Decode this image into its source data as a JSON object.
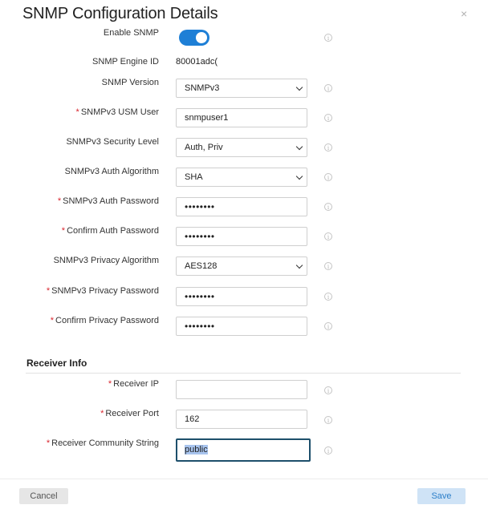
{
  "dialog": {
    "title": "SNMP Configuration Details"
  },
  "rows": [
    {
      "label": "Enable SNMP",
      "type": "toggle",
      "on": true
    },
    {
      "label": "SNMP Engine ID",
      "type": "text",
      "value": "80001adc("
    },
    {
      "label": "SNMP Version",
      "type": "select",
      "value": "SNMPv3"
    },
    {
      "label": "SNMPv3 USM User",
      "required": true,
      "type": "input",
      "value": "snmpuser1"
    },
    {
      "label": "SNMPv3 Security Level",
      "type": "select",
      "value": "Auth, Priv"
    },
    {
      "label": "SNMPv3 Auth Algorithm",
      "type": "select",
      "value": "SHA"
    },
    {
      "label": "SNMPv3 Auth Password",
      "required": true,
      "type": "password",
      "value": "••••••••"
    },
    {
      "label": "Confirm Auth Password",
      "required": true,
      "type": "password",
      "value": "••••••••"
    },
    {
      "label": "SNMPv3 Privacy Algorithm",
      "type": "select",
      "value": "AES128"
    },
    {
      "label": "SNMPv3 Privacy Password",
      "required": true,
      "type": "password",
      "value": "••••••••"
    },
    {
      "label": "Confirm Privacy Password",
      "required": true,
      "type": "password",
      "value": "••••••••"
    }
  ],
  "receiver": {
    "section_title": "Receiver Info",
    "rows": [
      {
        "label": "Receiver IP",
        "required": true,
        "type": "input",
        "value": ""
      },
      {
        "label": "Receiver Port",
        "required": true,
        "type": "input",
        "value": "162"
      },
      {
        "label": "Receiver Community String",
        "required": true,
        "type": "input",
        "value": "public",
        "focused": true
      }
    ]
  },
  "required_marker": "*",
  "info_glyph": "i",
  "close_glyph": "×",
  "footer": {
    "cancel_label": "Cancel",
    "save_label": "Save"
  },
  "colors": {
    "toggle_on": "#1e7fd6",
    "required": "#d9262f",
    "save_text": "#2c7fc9",
    "focus_border": "#1d4f6b"
  }
}
